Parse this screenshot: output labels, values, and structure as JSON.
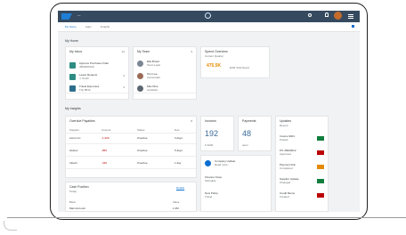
{
  "colors": {
    "shell": "#354a5f",
    "accent": "#0a6ed1",
    "negative": "#bb0000",
    "kpi": "#e58a00",
    "success": "#107e3e"
  },
  "shell": {
    "title": "—",
    "avatar_icon": "user-avatar-icon"
  },
  "subhead": {
    "tabs": [
      "My Home",
      "Apps",
      "Insights"
    ]
  },
  "sections": {
    "top": "My Home",
    "mid": "My Insights"
  },
  "cards": {
    "tasks": {
      "title": "My Inbox",
      "count": "12",
      "items": [
        {
          "title": "Approve Purchase Order",
          "sub": "4500000120"
        },
        {
          "title": "Leave Request",
          "sub": "J. Smith",
          "val": "2"
        },
        {
          "title": "Travel Expenses",
          "sub": "Trip 8812",
          "val": "4"
        }
      ]
    },
    "people": {
      "title": "My Team",
      "count": "3",
      "items": [
        {
          "title": "Ella Brown",
          "sub": "Team Lead"
        },
        {
          "title": "Tom Lee",
          "sub": "Accountant"
        },
        {
          "title": "Max Rice",
          "sub": "Assistant"
        }
      ]
    },
    "kpi": {
      "title": "Spend Overview",
      "sub": "Current Quarter",
      "value": "475.5K",
      "unit": "EUR Total Spent"
    }
  },
  "table": {
    "title": "Overdue Payables",
    "count": "8",
    "headers": [
      "Supplier",
      "Amount",
      "Status",
      "Due"
    ],
    "rows": [
      {
        "c1": "Acme Inc",
        "c2": "-1,200",
        "c3": "Overdue",
        "c4": "3 days"
      },
      {
        "c1": "Globex",
        "c2": "-850",
        "c3": "Overdue",
        "c4": "5 days"
      },
      {
        "c1": "Initech",
        "c2": "-430",
        "c3": "Overdue",
        "c4": "1 day"
      }
    ]
  },
  "bottom_card": {
    "title": "Cash Position",
    "sub": "Today",
    "link": "Details",
    "headers": [
      "Bank",
      "Value"
    ],
    "row": {
      "c1": "Main Account",
      "c2": "1.2M"
    }
  },
  "mini_cards": {
    "a": {
      "title": "Invoices",
      "value": "192",
      "unit": "K EUR"
    },
    "b": {
      "title": "Payments",
      "value": "48",
      "unit": "open"
    }
  },
  "side_list": {
    "title": "Updates",
    "sub": "Recent",
    "items": [
      {
        "title": "Invoice 9001",
        "sub": "Posted"
      },
      {
        "title": "PO 45000012",
        "sub": "Approved"
      },
      {
        "title": "Payment Run",
        "sub": "Completed"
      },
      {
        "title": "Supplier Update",
        "sub": "Changed"
      },
      {
        "title": "Credit Memo",
        "sub": "Created"
      }
    ]
  },
  "news": {
    "title": "News",
    "items": [
      {
        "title": "Company Update",
        "sub": "Read more"
      },
      {
        "title": "Finance Close",
        "sub": "Schedule"
      },
      {
        "title": "New Policy",
        "sub": "Travel"
      }
    ]
  }
}
